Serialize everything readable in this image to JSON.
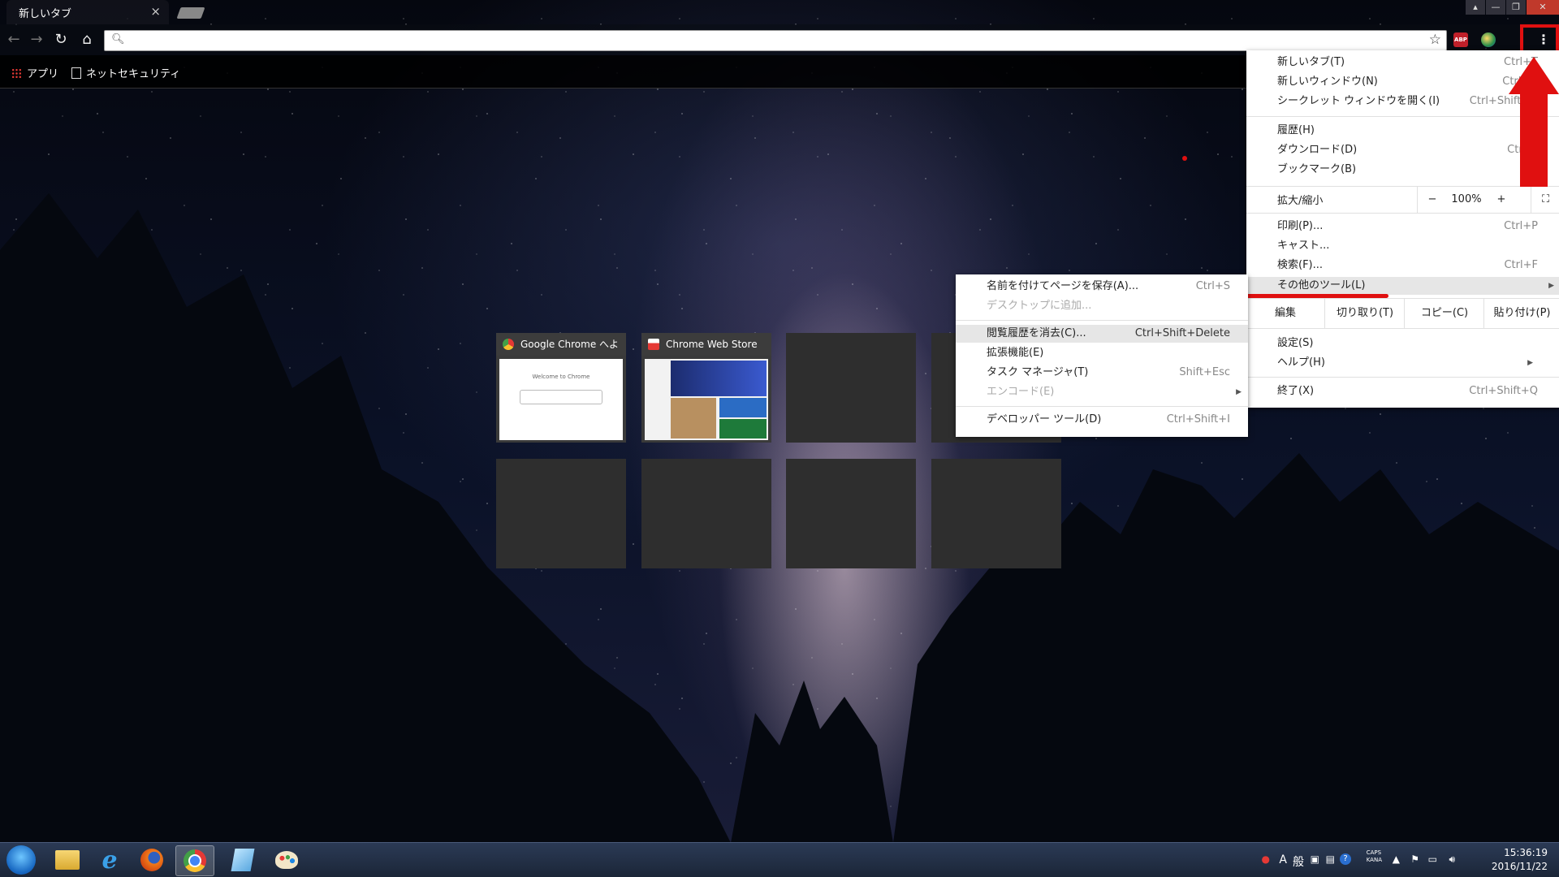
{
  "tab": {
    "title": "新しいタブ",
    "close": "×"
  },
  "bookmarks": [
    {
      "label": "アプリ"
    },
    {
      "label": "ネットセキュリティ"
    }
  ],
  "ext": {
    "abp": "ABP"
  },
  "tiles": [
    {
      "title": "Google Chrome へよ",
      "preview": "Welcome to Chrome"
    },
    {
      "title": "Chrome Web Store"
    }
  ],
  "menu": {
    "new_tab": "新しいタブ(T)",
    "new_tab_sc": "Ctrl+T",
    "new_window": "新しいウィンドウ(N)",
    "new_window_sc": "Ctrl+N",
    "incognito": "シークレット ウィンドウを開く(I)",
    "incognito_sc": "Ctrl+Shift+N",
    "history": "履歴(H)",
    "downloads": "ダウンロード(D)",
    "downloads_sc": "Ctrl+J",
    "bookmarks": "ブックマーク(B)",
    "zoom_label": "拡大/縮小",
    "zoom_minus": "−",
    "zoom_value": "100%",
    "zoom_plus": "+",
    "print": "印刷(P)...",
    "print_sc": "Ctrl+P",
    "cast": "キャスト...",
    "find": "検索(F)...",
    "find_sc": "Ctrl+F",
    "more_tools": "その他のツール(L)",
    "edit": "編集",
    "cut": "切り取り(T)",
    "copy": "コピー(C)",
    "paste": "貼り付け(P)",
    "settings": "設定(S)",
    "help": "ヘルプ(H)",
    "exit": "終了(X)",
    "exit_sc": "Ctrl+Shift+Q"
  },
  "submenu": {
    "save_page": "名前を付けてページを保存(A)...",
    "save_page_sc": "Ctrl+S",
    "add_desktop": "デスクトップに追加...",
    "clear_data": "閲覧履歴を消去(C)...",
    "clear_data_sc": "Ctrl+Shift+Delete",
    "extensions": "拡張機能(E)",
    "task_manager": "タスク マネージャ(T)",
    "task_manager_sc": "Shift+Esc",
    "encoding": "エンコード(E)",
    "devtools": "デベロッパー ツール(D)",
    "devtools_sc": "Ctrl+Shift+I"
  },
  "taskbar": {
    "ime_mode": "A",
    "ime_label": "般",
    "caps": "CAPS",
    "kana": "KANA",
    "time": "15:36:19",
    "date": "2016/11/22"
  },
  "colors": {
    "accent_red": "#e01010",
    "menu_bg": "#ffffff",
    "taskbar": "#1b2638"
  }
}
